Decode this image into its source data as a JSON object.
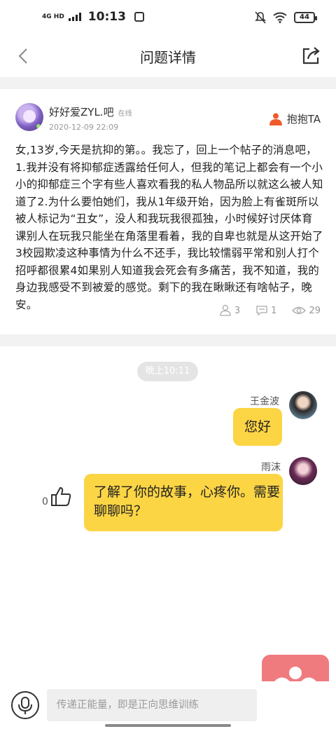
{
  "status_bar": {
    "network": "4G HD",
    "time": "10:13",
    "battery": "44"
  },
  "header": {
    "title": "问题详情"
  },
  "post": {
    "author": "好好爱ZYL.吧",
    "online_status": "在线",
    "date": "2020-12-09 22:09",
    "hug_label": "抱抱TA",
    "body": "女,13岁,今天是抗抑的第。。我忘了，回上一个帖子的消息吧，1.我并没有将抑郁症透露给任何人，但我的笔记上都会有一个小小的抑郁症三个字有些人喜欢看我的私人物品所以就这么被人知道了2.为什么要怕她们，我从1年级开始，因为脸上有雀斑所以被人标记为“丑女”，没人和我玩我很孤独，小时候好讨厌体育课别人在玩我只能坐在角落里看着，我的自卑也就是从这开始了3校园欺凌这种事情为什么不还手，我比较懦弱平常和别人打个招呼都很累4如果别人知道我会死会有多痛苦，我不知道，我的身边我感受不到被爱的感觉。剩下的我在瞅瞅还有啥帖子，晚安。",
    "stats": {
      "hugs": "3",
      "comments": "1",
      "views": "29"
    }
  },
  "chat": {
    "time_label": "晚上10:11",
    "messages": [
      {
        "sender": "王金波",
        "text": "您好"
      },
      {
        "sender": "雨沫",
        "text": "了解了你的故事，心疼你。需要聊聊吗？",
        "likes": "0"
      }
    ]
  },
  "input": {
    "placeholder": "传递正能量，即是正向思维训练"
  },
  "colors": {
    "bubble": "#fcd545",
    "accent": "#ef5b2a",
    "heart_button": "#ef7b7f"
  }
}
